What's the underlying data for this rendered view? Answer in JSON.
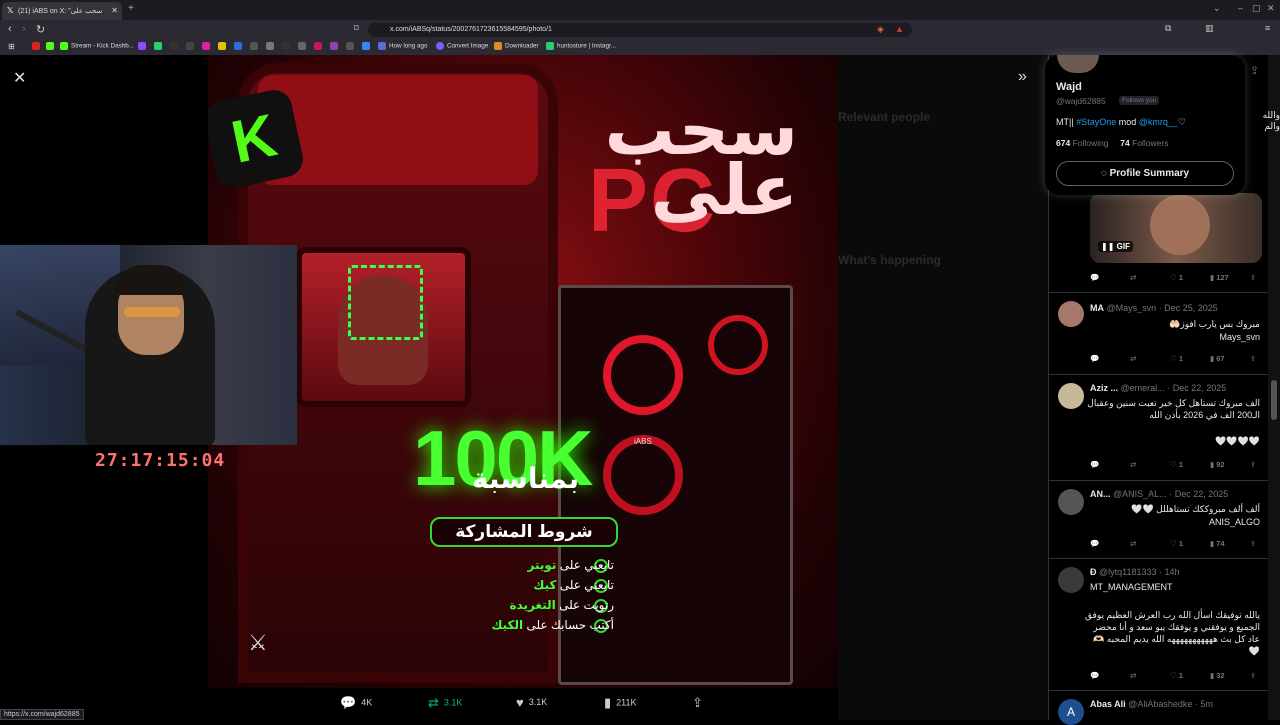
{
  "browser": {
    "tab_title": "(21) iABS on X: \"سحب على",
    "url": "x.com/iABSq/status/2002761723615584595/photo/1",
    "bookmarks": [
      "Stream - Kick Dashb...",
      "How long ago",
      "Convert Image",
      "Downloader",
      "huntostore | Instagr..."
    ],
    "status_url": "https://x.com/wajd62885"
  },
  "viewer": {
    "actions": {
      "replies": "4K",
      "reposts": "3.1K",
      "likes": "3.1K",
      "views": "211K"
    }
  },
  "poster": {
    "title": "سحب على",
    "pc_word": "PC",
    "milestone": "100K",
    "occasion": "بمناسبة",
    "rules_title": "شروط المشاركة",
    "rules": [
      {
        "text": "تابعني على",
        "highlight": "تويتر"
      },
      {
        "text": "تابعني على",
        "highlight": "كيك"
      },
      {
        "text": "رتويت على",
        "highlight": "التغريدة"
      },
      {
        "text": "أكتب حسابك على",
        "highlight": "الكيك"
      }
    ],
    "cabinet_label": "iABS",
    "kick_letter": "K"
  },
  "webcam": {
    "timer": "27:17:15:04"
  },
  "background_dim": {
    "relevant_people": "Relevant people",
    "whats_happening": "What's happening"
  },
  "hover_card": {
    "name": "Wajd",
    "handle": "@wajd62885",
    "follows_you": "Follows you",
    "bio_prefix": "MT||",
    "bio_tag": "#StayOne",
    "bio_mid": "mod",
    "bio_mention": "@kmrq__",
    "bio_suffix": "♡",
    "following_count": "674",
    "following_label": "Following",
    "followers_count": "74",
    "followers_label": "Followers",
    "summary_button": "Profile Summary"
  },
  "sidebar": {
    "top_text": "والله والم",
    "gif_label": "GIF",
    "posts": [
      {
        "name": "",
        "handle": "",
        "date": "",
        "text": "",
        "likes": "1",
        "views": "127"
      },
      {
        "name": "MA",
        "handle": "@Mays_svn",
        "date": "· Dec 25, 2025",
        "text": "مبروك بس يارب افوز🤲🏻",
        "text2": "Mays_svn",
        "likes": "1",
        "views": "67"
      },
      {
        "name": "Aziz ...",
        "handle": "@emeral...",
        "date": "· Dec 22, 2025",
        "text": "الف مبروك تستاهل كل خير تعبت سنين وعقبال الـ200 الف في 2026 بأذن الله",
        "text2": "🤍🤍🤍🤍",
        "likes": "1",
        "views": "92"
      },
      {
        "name": "AN...",
        "handle": "@ANIS_AL...",
        "date": "· Dec 22, 2025",
        "text": "ألف ألف مبروككك تستاهللل 🤍🤍",
        "text2": "ANIS_ALGO",
        "likes": "1",
        "views": "74"
      },
      {
        "name": "Ð",
        "handle": "@lytq1181333",
        "date": "· 14h",
        "text": "MT_MANAGEMENT",
        "text2": "يالله توفيقك اسأل الله رب العرش العظيم يوفق الجميع و يوفقني و يوفقك يبو سعد و أنا محضر عاد كل بث هههههههههههه الله يديم المحبه 🫶🏻🤍",
        "likes": "1",
        "views": "32"
      },
      {
        "name": "Abas Ali",
        "handle": "@AliAbashedke",
        "date": "· 5m",
        "text": "",
        "likes": "",
        "views": ""
      }
    ]
  },
  "colors": {
    "accent_green": "#53fc18",
    "link_blue": "#1d9bf0",
    "poster_red": "#8a0f14"
  }
}
